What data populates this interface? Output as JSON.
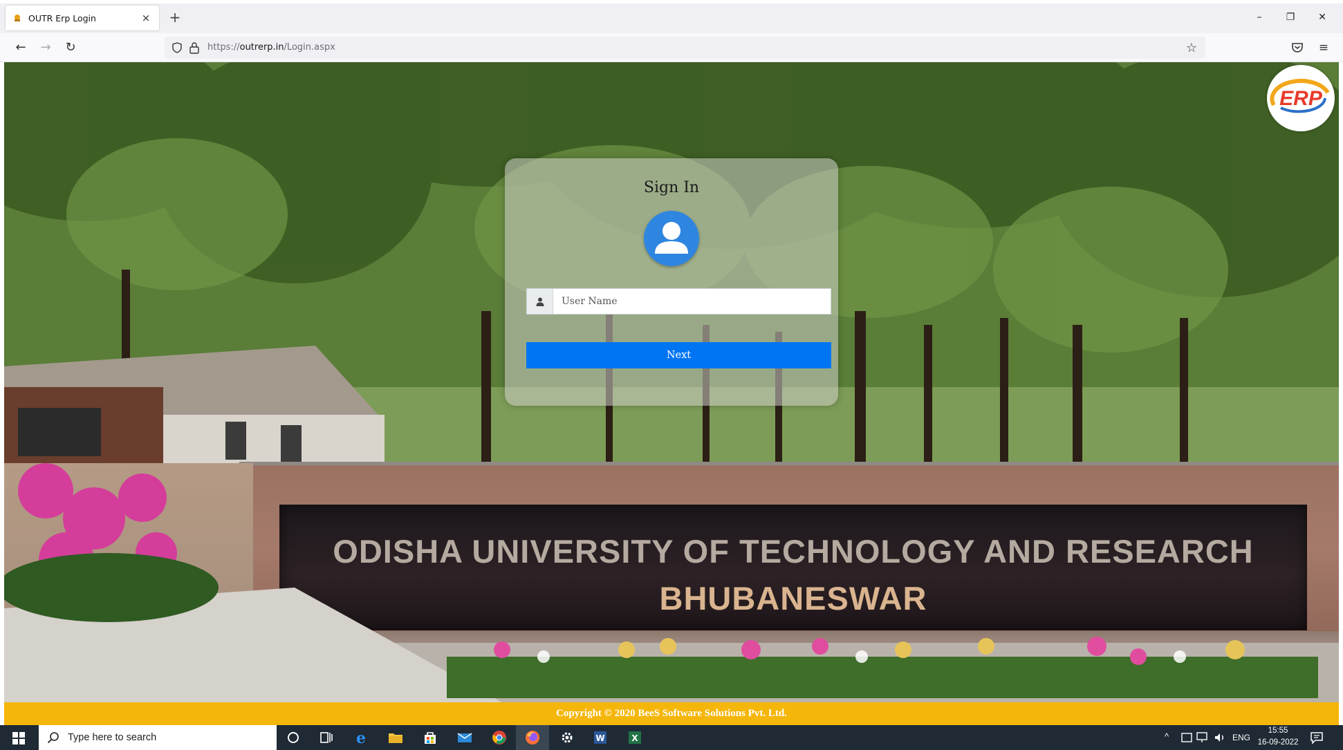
{
  "browser": {
    "tab_title": "OUTR Erp Login",
    "tab_close": "×",
    "new_tab": "+",
    "url": "https://outrerp.in/Login.aspx",
    "url_scheme": "https://",
    "url_domain": "outrerp.in",
    "url_path": "/Login.aspx",
    "window": {
      "minimize": "–",
      "restore": "❐",
      "close": "✕"
    },
    "nav": {
      "back": "←",
      "forward": "→",
      "reload": "↻",
      "star": "☆",
      "menu": "≡"
    }
  },
  "banner": {
    "line1": "ODISHA UNIVERSITY OF TECHNOLOGY AND RESEARCH",
    "line2": "BHUBANESWAR"
  },
  "logo": {
    "text": "ERP"
  },
  "signin": {
    "title": "Sign In",
    "username_placeholder": "User Name",
    "username_value": "",
    "next_label": "Next"
  },
  "footer": {
    "copyright": "Copyright © 2020 BeeS Software Solutions Pvt. Ltd."
  },
  "taskbar": {
    "search_placeholder": "Type here to search",
    "language": "ENG",
    "time": "15:55",
    "date": "16-09-2022"
  },
  "colors": {
    "primary_button": "#0075f4",
    "footer_bar": "#f5b60a",
    "avatar": "#2f86e0",
    "taskbar": "#1f2a35"
  }
}
